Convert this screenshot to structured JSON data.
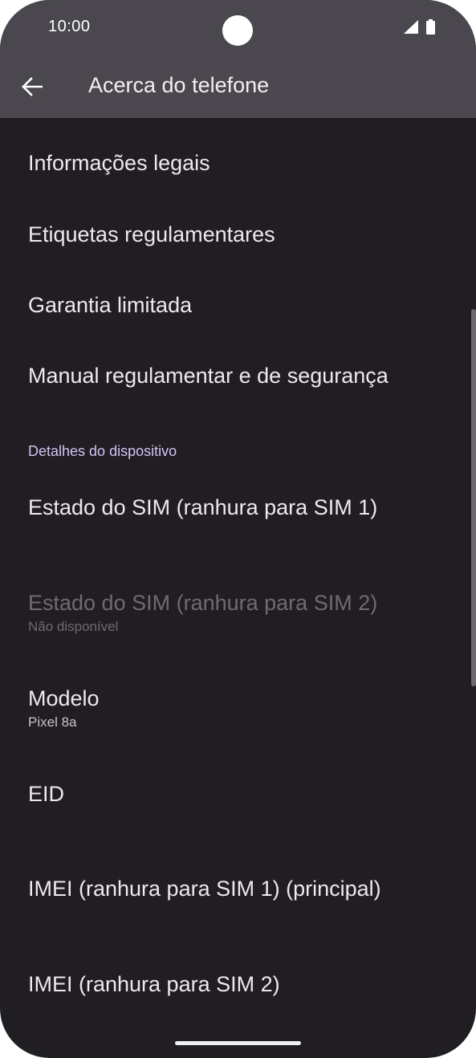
{
  "status_bar": {
    "time": "10:00"
  },
  "app_bar": {
    "title": "Acerca do telefone",
    "back_icon": "arrow-left-icon"
  },
  "items_top": [
    {
      "title": "Informações legais"
    },
    {
      "title": "Etiquetas regulamentares"
    },
    {
      "title": "Garantia limitada"
    },
    {
      "title": "Manual regulamentar e de segurança"
    }
  ],
  "section": {
    "header": "Detalhes do dispositivo"
  },
  "items_device": [
    {
      "title": "Estado do SIM (ranhura para SIM 1)"
    },
    {
      "title": "Estado do SIM (ranhura para SIM 2)",
      "summary": "Não disponível",
      "disabled": true
    },
    {
      "title": "Modelo",
      "summary": "Pixel 8a"
    },
    {
      "title": "EID"
    },
    {
      "title": "IMEI (ranhura para SIM 1) (principal)"
    },
    {
      "title": "IMEI (ranhura para SIM 2)"
    }
  ],
  "colors": {
    "background": "#201e23",
    "app_bar": "#4a484e",
    "section_header": "#d6c2f5",
    "disabled_text": "#6e6a72"
  }
}
